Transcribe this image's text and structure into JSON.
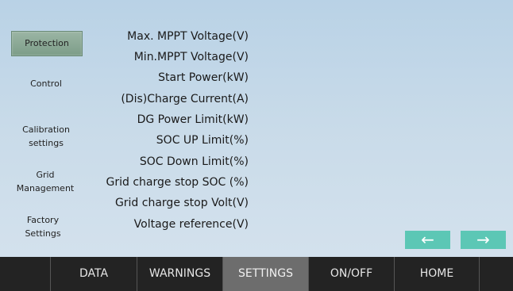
{
  "sidebar": {
    "items": [
      {
        "label": "Protection",
        "active": true
      },
      {
        "label": "Control",
        "active": false
      },
      {
        "label_lines": [
          "Calibration",
          "settings"
        ],
        "active": false
      },
      {
        "label_lines": [
          "Grid",
          "Management"
        ],
        "active": false
      },
      {
        "label_lines": [
          "Factory",
          "Settings"
        ],
        "active": false
      }
    ]
  },
  "params": [
    "Max. MPPT Voltage(V)",
    "Min.MPPT Voltage(V)",
    "Start Power(kW)",
    "(Dis)Charge Current(A)",
    "DG Power Limit(kW)",
    "SOC UP Limit(%)",
    "SOC  Down Limit(%)",
    "Grid charge stop SOC (%)",
    "Grid charge stop Volt(V)",
    "Voltage reference(V)"
  ],
  "nav": {
    "prev_icon": "←",
    "next_icon": "→"
  },
  "bottom_tabs": [
    "",
    "DATA",
    "WARNINGS",
    "SETTINGS",
    "ON/OFF",
    "HOME",
    ""
  ],
  "active_tab": "SETTINGS",
  "colors": {
    "background": "#c9dbe9",
    "active_sidebar": "#8aa895",
    "arrow_button": "#5cc7b5",
    "bottom_bar": "#232323",
    "active_tab": "#6d6d6d"
  }
}
